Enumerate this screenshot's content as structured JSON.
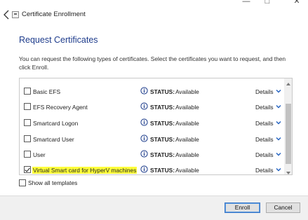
{
  "window": {
    "title": "Certificate Enrollment",
    "minimize_glyph": "—",
    "maximize_glyph": "□",
    "close_glyph": "✕"
  },
  "page": {
    "heading": "Request Certificates",
    "description": "You can request the following types of certificates. Select the certificates you want to request, and then click Enroll."
  },
  "certificates": [
    {
      "name": "Basic EFS",
      "checked": false,
      "highlighted": false,
      "status_key": "STATUS:",
      "status": "Available",
      "details": "Details"
    },
    {
      "name": "EFS Recovery Agent",
      "checked": false,
      "highlighted": false,
      "status_key": "STATUS:",
      "status": "Available",
      "details": "Details"
    },
    {
      "name": "Smartcard Logon",
      "checked": false,
      "highlighted": false,
      "status_key": "STATUS:",
      "status": "Available",
      "details": "Details"
    },
    {
      "name": "Smartcard User",
      "checked": false,
      "highlighted": false,
      "status_key": "STATUS:",
      "status": "Available",
      "details": "Details"
    },
    {
      "name": "User",
      "checked": false,
      "highlighted": false,
      "status_key": "STATUS:",
      "status": "Available",
      "details": "Details"
    },
    {
      "name": "Virtual Smart card for HyperV machines",
      "checked": true,
      "highlighted": true,
      "status_key": "STATUS:",
      "status": "Available",
      "details": "Details"
    }
  ],
  "options": {
    "show_all_label": "Show all templates",
    "show_all_checked": false
  },
  "buttons": {
    "enroll": "Enroll",
    "cancel": "Cancel"
  },
  "colors": {
    "heading": "#1e3c8c",
    "highlight": "#ffff3a",
    "info_icon": "#1a3a8a",
    "details_chevron": "#1f5fbf"
  },
  "icons": {
    "back": "back-arrow-icon",
    "app": "certificate-icon",
    "info": "info-icon",
    "chevron": "chevron-down-icon"
  }
}
